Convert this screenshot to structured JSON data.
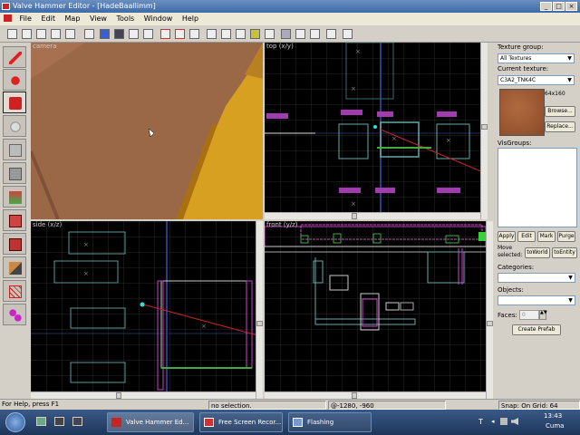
{
  "window": {
    "title": "Valve Hammer Editor - [HadeBaallimm]",
    "min": "_",
    "max": "□",
    "close": "×"
  },
  "menu": [
    "File",
    "Edit",
    "Map",
    "View",
    "Tools",
    "Window",
    "Help"
  ],
  "viewports": {
    "camera": "camera",
    "top": "top (x/y)",
    "side": "side (x/z)",
    "front": "front (y/z)"
  },
  "texture": {
    "group_label": "Texture group:",
    "group_value": "All Textures",
    "current_label": "Current texture:",
    "current_value": "C3A2_TNK4C",
    "size": "64x160",
    "browse": "Browse...",
    "replace": "Replace..."
  },
  "visgroups": {
    "label": "VisGroups:"
  },
  "visgroup_buttons": [
    "Apply",
    "Edit",
    "Mark",
    "Purge"
  ],
  "move": {
    "label": "Move selected:",
    "to_world": "toWorld",
    "to_entity": "toEntity"
  },
  "categories": {
    "label": "Categories:"
  },
  "objects": {
    "label": "Objects:"
  },
  "faces": {
    "label": "Faces:",
    "value": "0"
  },
  "create_prefab": "Create Prefab",
  "status": {
    "help": "For Help, press F1",
    "selection": "no selection.",
    "coords": "@-1280, -960",
    "snap": "Snap: On Grid: 64"
  },
  "taskbar": {
    "tasks": [
      "Valve Hammer Ed...",
      "Free Screen Recor...",
      "Flashing"
    ],
    "lang": "T",
    "time": "13:43",
    "day": "Cuma"
  },
  "colors": {
    "selection_red": "#cc2020",
    "brush_white": "#d0d0d0",
    "entity_magenta": "#e040e0",
    "grid": "#1e1e1e"
  }
}
